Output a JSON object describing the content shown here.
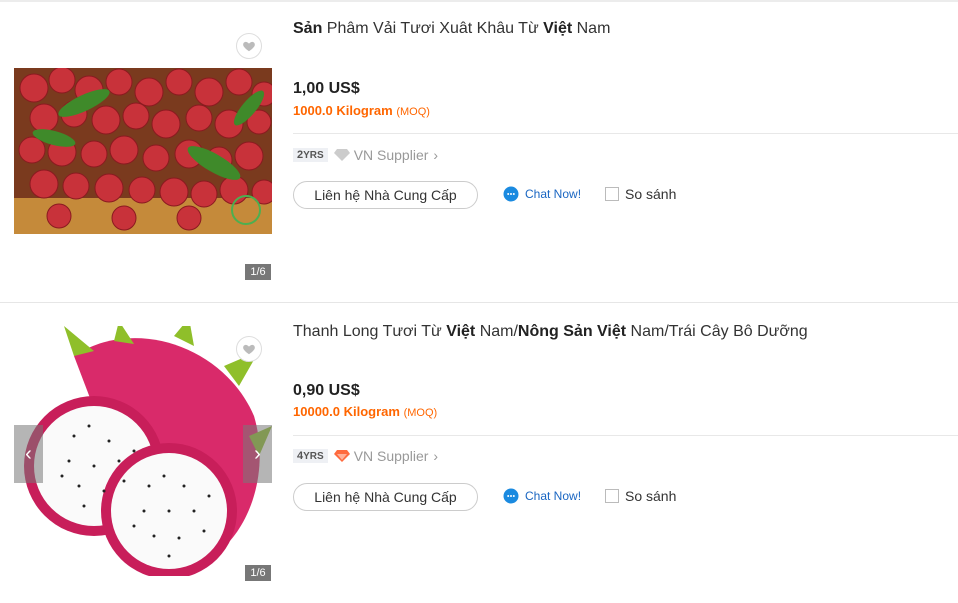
{
  "products": [
    {
      "title_parts": [
        {
          "text": "Sản",
          "bold": true
        },
        {
          "text": " Phâm Vải Tươi Xuât Khâu Từ ",
          "bold": false
        },
        {
          "text": "Việt",
          "bold": true
        },
        {
          "text": " Nam",
          "bold": false
        }
      ],
      "price": "1,00 US$",
      "moq_qty": "1000.0 Kilogram",
      "moq_label": "(MOQ)",
      "years_num": "2",
      "years_unit": "YRS",
      "supplier": "VN Supplier",
      "supplier_icon": "diamond-grey-icon",
      "contact_label": "Liên hệ Nhà Cung Cấp",
      "chat_label": "Chat Now!",
      "compare_label": "So sánh",
      "image_counter": "1/6"
    },
    {
      "title_parts": [
        {
          "text": "Thanh Long Tươi Từ ",
          "bold": false
        },
        {
          "text": "Việt",
          "bold": true
        },
        {
          "text": " Nam/",
          "bold": false
        },
        {
          "text": "Nông Sản Việt",
          "bold": true
        },
        {
          "text": " Nam/Trái Cây Bô Dưỡng",
          "bold": false
        }
      ],
      "price": "0,90 US$",
      "moq_qty": "10000.0 Kilogram",
      "moq_label": "(MOQ)",
      "years_num": "4",
      "years_unit": "YRS",
      "supplier": "VN Supplier",
      "supplier_icon": "diamond-orange-icon",
      "contact_label": "Liên hệ Nhà Cung Cấp",
      "chat_label": "Chat Now!",
      "compare_label": "So sánh",
      "image_counter": "1/6"
    }
  ],
  "colors": {
    "accent": "#ff6600",
    "link": "#1a66c2",
    "price": "#222222"
  }
}
